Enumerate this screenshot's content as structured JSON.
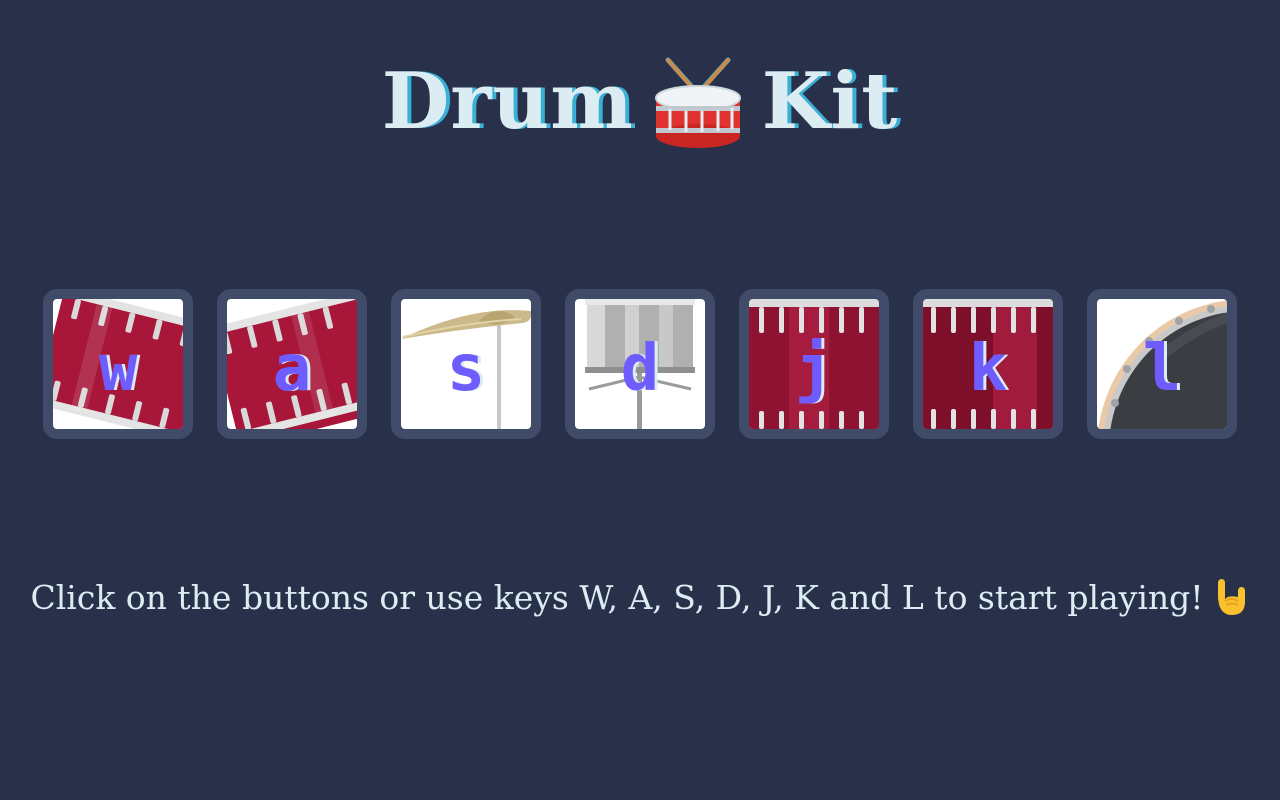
{
  "header": {
    "title_start": "Drum",
    "title_icon": "drum-icon",
    "title_end": "Kit"
  },
  "drums": [
    {
      "key": "w",
      "icon": "tom-1-icon"
    },
    {
      "key": "a",
      "icon": "tom-2-icon"
    },
    {
      "key": "s",
      "icon": "cymbal-icon"
    },
    {
      "key": "d",
      "icon": "snare-icon"
    },
    {
      "key": "j",
      "icon": "tom-3-icon"
    },
    {
      "key": "k",
      "icon": "tom-4-icon"
    },
    {
      "key": "l",
      "icon": "bass-drum-icon"
    }
  ],
  "footer": {
    "instructions": "Click on the buttons or use keys W, A, S, D, J, K and L to start playing!",
    "icon": "rock-on-hand-icon"
  },
  "colors": {
    "background": "#283149",
    "button_border": "#404b69",
    "title_text": "#dbedf3",
    "title_shadow": "#3bb0d6",
    "key_letter": "#6f5cff",
    "drum_red": "#a8173a"
  }
}
